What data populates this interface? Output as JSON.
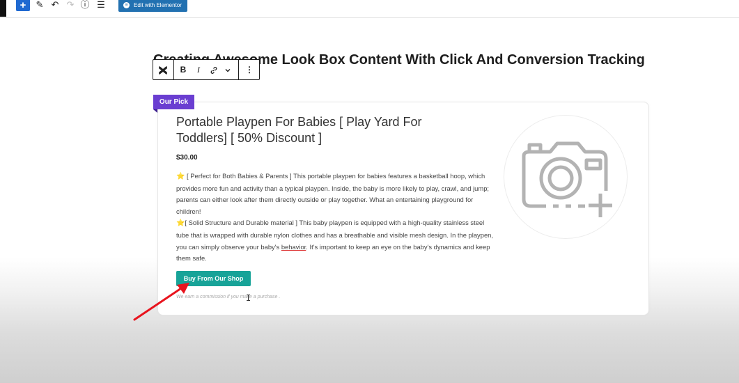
{
  "toolbar": {
    "add_label": "+",
    "edit_icon_glyph": "✎",
    "undo_glyph": "↶",
    "redo_glyph": "↷",
    "info_glyph": "ⓘ",
    "list_glyph": "☰",
    "elementor_label": "Edit with Elementor",
    "elementor_icon": "≡"
  },
  "page": {
    "title": "Creating Awesome Look Box Content With Click And Conversion Tracking"
  },
  "block_toolbar": {
    "bold": "B",
    "italic": "I",
    "more": "⋮"
  },
  "product": {
    "badge": "Our Pick",
    "title": "Portable Playpen For Babies [ Play Yard For Toddlers] [ 50% Discount ]",
    "price": "$30.00",
    "star": "⭐",
    "desc_1": " [ Perfect for Both Babies & Parents ] This portable playpen for babies features a basketball hoop, which provides more fun and activity than a typical playpen. Inside, the baby is more likely to play, crawl, and jump; parents can either look after them directly outside or play together. What an entertaining playground for children!",
    "desc_2a": "[ Solid Structure and Durable material ] This baby playpen is equipped with a high-quality stainless steel tube that is wrapped with durable nylon clothes and has a breathable and visible mesh design. In the playpen, you can simply observe your baby's ",
    "desc_2_underlined": "behavior",
    "desc_2b": ". It's important to keep an eye on the baby's dynamics and keep them safe.",
    "buy_button": "Buy From Our Shop",
    "commission_note": "We earn a commission if you make a purchase ."
  },
  "colors": {
    "accent": "#2271b1",
    "badge": "#6a3ed1",
    "buy_button": "#17a398",
    "annotation_arrow": "#e8141e"
  },
  "icons": {
    "image_placeholder": "camera-plus-icon",
    "annotation": "red-arrow-icon"
  }
}
